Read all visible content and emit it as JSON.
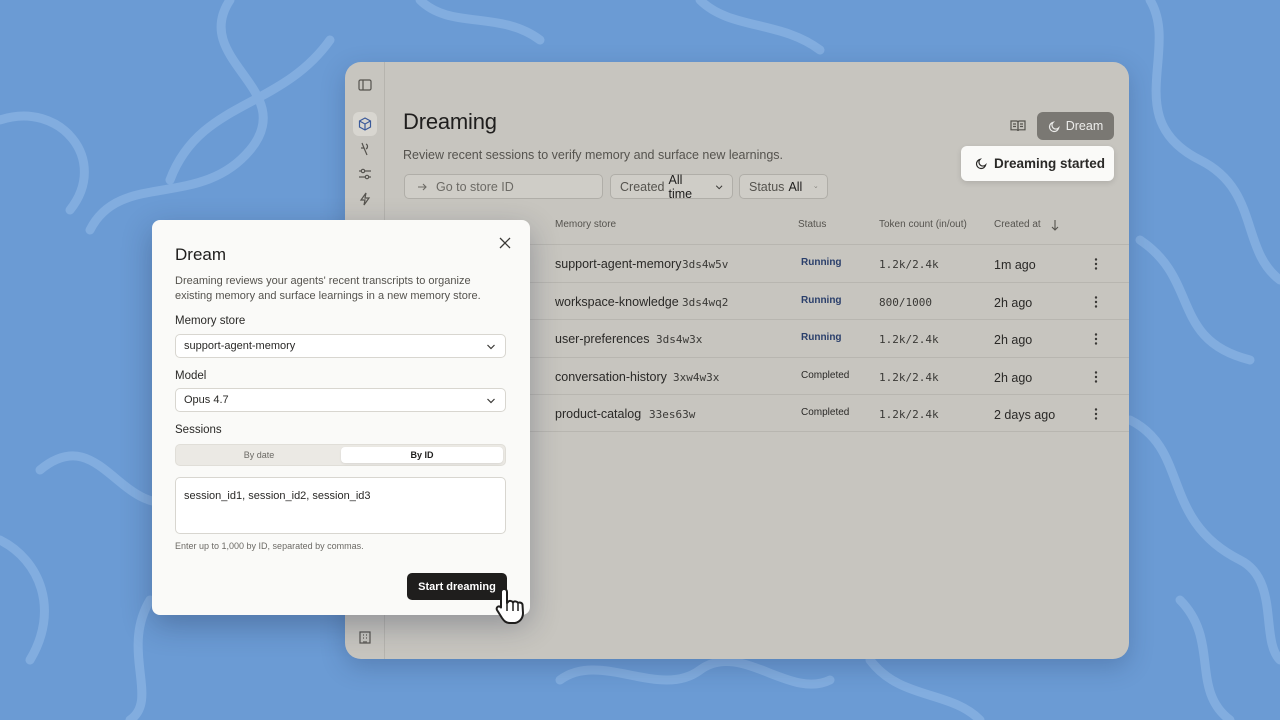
{
  "page": {
    "title": "Dreaming",
    "subtitle": "Review recent sessions to verify memory and surface new learnings.",
    "dream_button": "Dream",
    "toast": "Dreaming started",
    "store_search": {
      "placeholder": "Go to store ID"
    },
    "filters": {
      "created_label": "Created",
      "created_value": "All time",
      "status_label": "Status",
      "status_value": "All"
    }
  },
  "table": {
    "headers": {
      "memory_store": "Memory store",
      "status": "Status",
      "tokens": "Token count (in/out)",
      "created": "Created at"
    },
    "rows": [
      {
        "name": "support-agent-memory",
        "id": "3ds4w5v",
        "status": "Running",
        "tokens": "1.2k/2.4k",
        "created": "1m ago"
      },
      {
        "name": "workspace-knowledge",
        "id": "3ds4wq2",
        "status": "Running",
        "tokens": "800/1000",
        "created": "2h ago"
      },
      {
        "name": "user-preferences",
        "id": "3ds4w3x",
        "status": "Running",
        "tokens": "1.2k/2.4k",
        "created": "2h ago"
      },
      {
        "name": "conversation-history",
        "id": "3xw4w3x",
        "status": "Completed",
        "tokens": "1.2k/2.4k",
        "created": "2h ago"
      },
      {
        "name": "product-catalog",
        "id": "33es63w",
        "status": "Completed",
        "tokens": "1.2k/2.4k",
        "created": "2 days ago"
      }
    ]
  },
  "dialog": {
    "title": "Dream",
    "description": "Dreaming reviews your agents' recent transcripts to organize existing memory and surface learnings in a new memory store.",
    "memory_store_label": "Memory store",
    "memory_store_value": "support-agent-memory",
    "model_label": "Model",
    "model_value": "Opus 4.7",
    "sessions_label": "Sessions",
    "seg_by_date": "By date",
    "seg_by_id": "By ID",
    "sessions_value": "session_id1, session_id2, session_id3",
    "hint": "Enter up to 1,000 by ID, separated by commas.",
    "submit": "Start dreaming"
  },
  "colors": {
    "background": "#6b9bd4",
    "window": "#c7c5bf",
    "running_text": "#2a3f6b",
    "primary_button": "#1f1e1d"
  }
}
